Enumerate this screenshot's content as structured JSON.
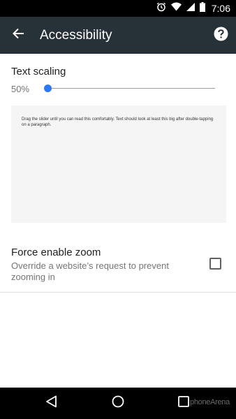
{
  "status_bar": {
    "time": "7:06",
    "icons": [
      "alarm-icon",
      "wifi-icon",
      "cell-signal-icon",
      "battery-icon"
    ]
  },
  "app_bar": {
    "title": "Accessibility",
    "back_icon": "arrow-back-icon",
    "help_icon": "help-icon",
    "color": "#263238"
  },
  "text_scaling": {
    "title": "Text scaling",
    "value_label": "50%",
    "slider_fraction": 0.0,
    "accent": "#2979ff",
    "preview_text": "Drag the slider until you can read this comfortably. Text should look at least this big after double-tapping on a paragraph."
  },
  "force_zoom": {
    "title": "Force enable zoom",
    "summary": "Override a website’s request to prevent zooming in",
    "checked": false
  },
  "nav_bar": {
    "back_icon": "nav-back-icon",
    "home_icon": "nav-home-icon",
    "recents_icon": "nav-recents-icon"
  },
  "watermark": "phoneArena"
}
